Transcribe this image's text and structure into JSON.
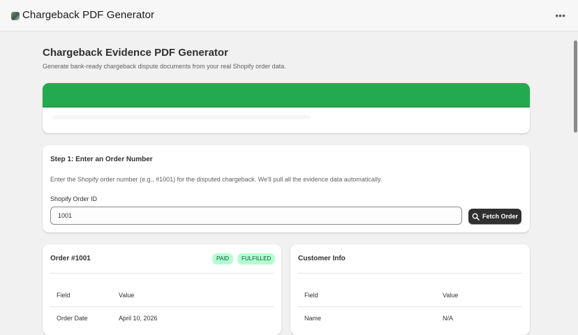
{
  "window": {
    "title": "Chargeback PDF Generator",
    "menu_label": "•••"
  },
  "page": {
    "heading": "Chargeback Evidence PDF Generator",
    "subheading": "Generate bank-ready chargeback dispute documents from your real Shopify order data."
  },
  "banner": {
    "color": "#23aa4e"
  },
  "step1": {
    "title": "Step 1: Enter an Order Number",
    "description": "Enter the Shopify order number (e.g., #1001) for the disputed chargeback. We'll pull all the evidence data automatically.",
    "field_label": "Shopify Order ID",
    "field_value": "1001",
    "button_label": "Fetch Order"
  },
  "order": {
    "title": "Order #1001",
    "badges": [
      "PAID",
      "FULFILLED"
    ],
    "headers": [
      "Field",
      "Value"
    ],
    "rows": [
      [
        "Order Date",
        "April 10, 2026"
      ]
    ]
  },
  "customer": {
    "title": "Customer Info",
    "headers": [
      "Field",
      "Value"
    ],
    "rows": [
      [
        "Name",
        "N/A"
      ]
    ]
  },
  "icons": {
    "app": "app-icon",
    "search": "search-icon"
  }
}
